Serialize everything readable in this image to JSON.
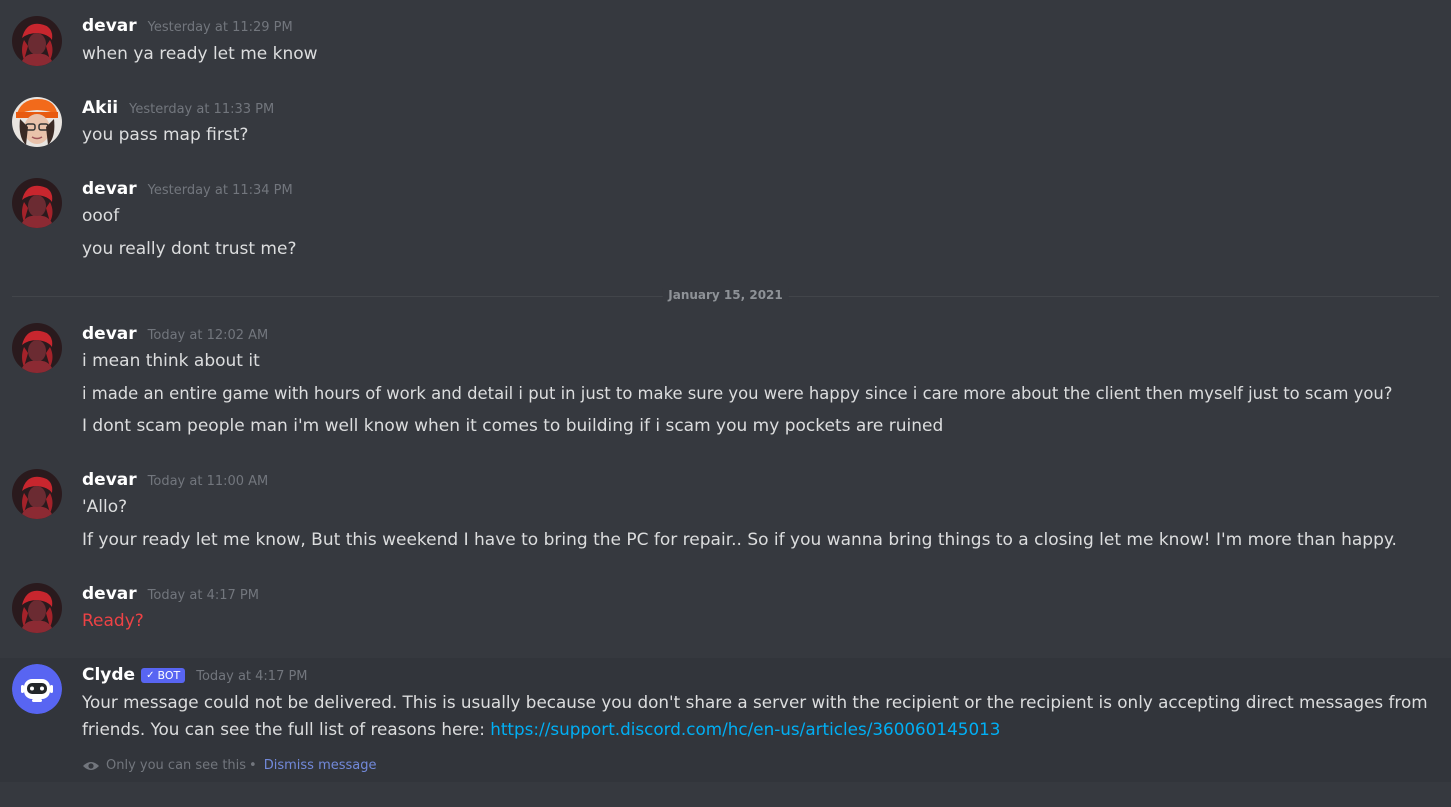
{
  "divider": {
    "label": "January 15, 2021"
  },
  "messages": [
    {
      "author": "devar",
      "time": "Yesterday at 11:29 PM",
      "lines": [
        "when ya ready let me know"
      ]
    },
    {
      "author": "Akii",
      "time": "Yesterday at 11:33 PM",
      "lines": [
        "you pass map first?"
      ]
    },
    {
      "author": "devar",
      "time": "Yesterday at 11:34 PM",
      "lines": [
        "ooof",
        "you really dont trust me?"
      ]
    },
    {
      "author": "devar",
      "time": "Today at 12:02 AM",
      "lines": [
        "i mean think about it",
        "i made an entire game with hours of work and detail i put in just to make sure you were happy since i care more about the client then myself just to scam you?",
        "I dont scam people man i'm well know when it comes to building if i scam you my pockets are ruined"
      ]
    },
    {
      "author": "devar",
      "time": "Today at 11:00 AM",
      "lines": [
        "'Allo?",
        "If your ready let me know, But this weekend I have to bring the PC for repair.. So if you wanna bring things to a closing let me know! I'm more than happy."
      ]
    },
    {
      "author": "devar",
      "time": "Today at 4:17 PM",
      "lines": [
        "Ready?"
      ]
    }
  ],
  "clyde": {
    "author": "Clyde",
    "badge": "BOT",
    "badge_check": "✓",
    "time": "Today at 4:17 PM",
    "line1": "Your message could not be delivered. This is usually because you don't share a server with the recipient or the recipient is only accepting direct messages from",
    "line2_prefix": "friends. You can see the full list of reasons here: ",
    "link": "https://support.discord.com/hc/en-us/articles/360060145013",
    "only_you": "Only you can see this",
    "separator": "•",
    "dismiss": "Dismiss message"
  },
  "colors": {
    "background": "#36393f",
    "failed_text": "#ed4245",
    "link": "#00aff4",
    "badge": "#5865f2"
  },
  "icons": {
    "devar_avatar": "avatar-red-hair",
    "akii_avatar": "avatar-orange-cap",
    "clyde_avatar": "clyde-bot-avatar",
    "eye": "eye-icon"
  }
}
